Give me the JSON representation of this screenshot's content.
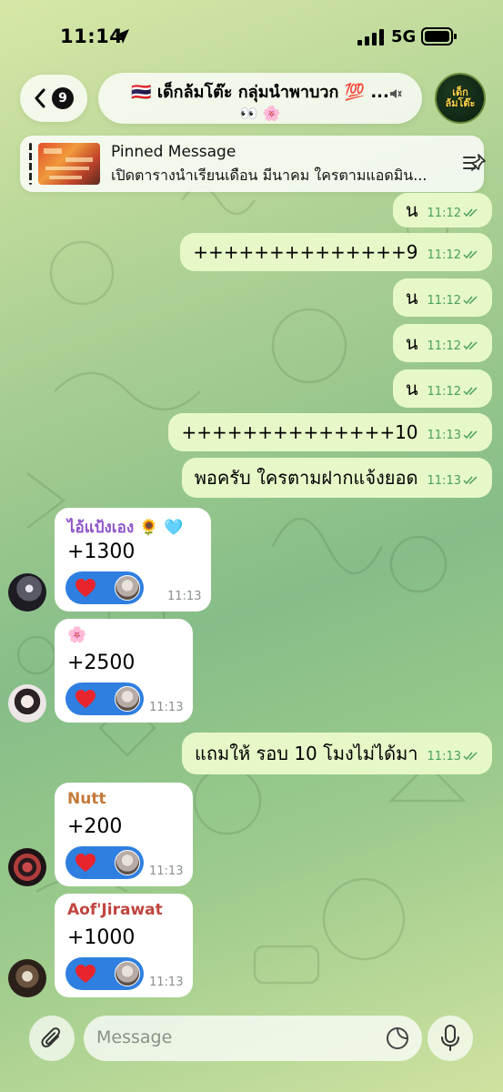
{
  "status_bar": {
    "time": "11:14",
    "network": "5G"
  },
  "header": {
    "back_count": "9",
    "title": "🇹🇭 เด็กล้มโต๊ะ กลุ่มนำพาบวก 💯 ...",
    "subtitle": "👀 🌸",
    "avatar_text_1": "เด็ก",
    "avatar_text_2": "ล้มโต๊ะ"
  },
  "pinned": {
    "title": "Pinned Message",
    "text": "เปิดตารางนำเรียนเดือน มีนาคม ใครตามแอดมิน..."
  },
  "messages": [
    {
      "type": "out",
      "text": "น",
      "time": "11:12"
    },
    {
      "type": "out",
      "text": "++++++++++++++9",
      "time": "11:12"
    },
    {
      "type": "out",
      "text": "น",
      "time": "11:12"
    },
    {
      "type": "out",
      "text": "น",
      "time": "11:12"
    },
    {
      "type": "out",
      "text": "น",
      "time": "11:12"
    },
    {
      "type": "out",
      "text": "++++++++++++++10",
      "time": "11:13"
    },
    {
      "type": "out",
      "text": "พอครับ ใครตามฝากแจ้งยอด",
      "time": "11:13"
    },
    {
      "type": "in",
      "sender": "ไอ้แป้งเอง 🌻 🩵",
      "sender_color": "#8e54c9",
      "text": "+1300",
      "time": "11:13"
    },
    {
      "type": "in",
      "sender": "🌸",
      "sender_color": "#d0508a",
      "text": "+2500",
      "time": "11:13"
    },
    {
      "type": "out",
      "text": "แถมให้ รอบ 10 โมงไม่ได้มา",
      "time": "11:13"
    },
    {
      "type": "in",
      "sender": "Nutt",
      "sender_color": "#c47a3a",
      "text": "+200",
      "time": "11:13"
    },
    {
      "type": "in",
      "sender": "Aof'Jirawat",
      "sender_color": "#c0453e",
      "text": "+1000",
      "time": "11:13"
    }
  ],
  "composer": {
    "placeholder": "Message"
  },
  "colors": {
    "outgoing_bubble": "#e6f8c8",
    "reaction": "#2f7fe0",
    "check": "#4ba05a"
  }
}
